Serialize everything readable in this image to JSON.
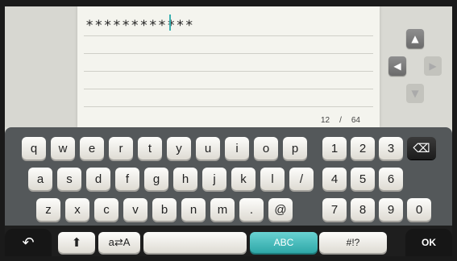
{
  "input": {
    "value": "************",
    "char_count": "12",
    "separator": "/",
    "max_chars": "64"
  },
  "keyboard": {
    "row1_letters": [
      "q",
      "w",
      "e",
      "r",
      "t",
      "y",
      "u",
      "i",
      "o",
      "p"
    ],
    "row2_letters": [
      "a",
      "s",
      "d",
      "f",
      "g",
      "h",
      "j",
      "k",
      "l",
      "/"
    ],
    "row3_letters": [
      "z",
      "x",
      "c",
      "v",
      "b",
      "n",
      "m",
      ".",
      "@"
    ],
    "digits_row1": [
      "1",
      "2",
      "3"
    ],
    "digits_row2": [
      "4",
      "5",
      "6"
    ],
    "digits_row3": [
      "7",
      "8",
      "9",
      "0"
    ],
    "case_toggle_label": "a⇄A",
    "mode_abc_label": "ABC",
    "mode_symbols_label": "#!?"
  },
  "footer": {
    "ok_label": "OK"
  },
  "icons": {
    "backspace": "backspace-icon",
    "shift": "shift-icon",
    "back": "back-icon",
    "up": "up-arrow-icon",
    "left": "left-arrow-icon",
    "right": "right-arrow-icon",
    "down": "down-arrow-icon"
  },
  "colors": {
    "accent_teal": "#3ab0b0",
    "keyboard_bg": "#54585a"
  }
}
